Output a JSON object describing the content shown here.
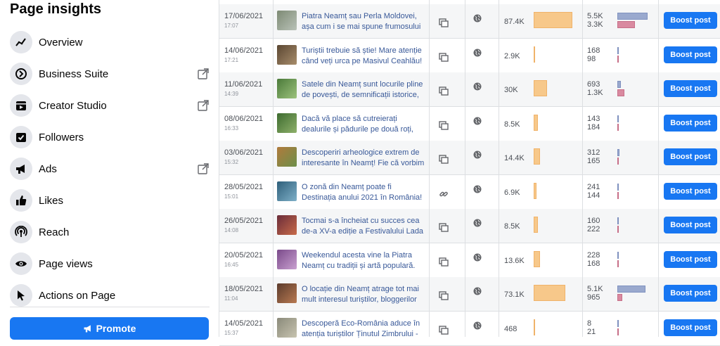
{
  "sidebar": {
    "title": "Page insights",
    "items": [
      {
        "label": "Overview",
        "icon": "trend-icon",
        "external": false
      },
      {
        "label": "Business Suite",
        "icon": "business-suite-icon",
        "external": true
      },
      {
        "label": "Creator Studio",
        "icon": "creator-studio-icon",
        "external": true
      },
      {
        "label": "Followers",
        "icon": "followers-icon",
        "external": false
      },
      {
        "label": "Ads",
        "icon": "megaphone-icon",
        "external": true
      },
      {
        "label": "Likes",
        "icon": "thumbs-up-icon",
        "external": false
      },
      {
        "label": "Reach",
        "icon": "broadcast-icon",
        "external": false
      },
      {
        "label": "Page views",
        "icon": "eye-icon",
        "external": false
      },
      {
        "label": "Actions on Page",
        "icon": "cursor-icon",
        "external": false
      }
    ],
    "promote_label": "Promote"
  },
  "colors": {
    "accent": "#1877f2",
    "reach_bar": "#f7c88a",
    "engagement_bar_1": "#9aa9ce",
    "engagement_bar_2": "#d98aa0"
  },
  "posts": [
    {
      "date": "17/06/2021",
      "time": "17:07",
      "text": "Piatra Neamț sau Perla Moldovei, așa cum i se mai spune frumosului oraș",
      "type": "copy-icon",
      "reach": "87.4K",
      "reach_fraction": 0.88,
      "eng1": "5.5K",
      "eng2": "3.3K",
      "eng1_fraction": 0.82,
      "eng2_fraction": 0.49,
      "boost": "Boost post",
      "thumb": [
        "#7d8a74",
        "#b9c2b8"
      ]
    },
    {
      "date": "14/06/2021",
      "time": "17:21",
      "text": "Turiștii trebuie să știe! Mare atenție când veți urca pe Masivul Ceahlău!",
      "type": "copy-icon",
      "reach": "2.9K",
      "reach_fraction": 0.03,
      "eng1": "168",
      "eng2": "98",
      "eng1_fraction": 0.03,
      "eng2_fraction": 0.02,
      "boost": "Boost post",
      "thumb": [
        "#5a4632",
        "#a88d6b"
      ]
    },
    {
      "date": "11/06/2021",
      "time": "14:39",
      "text": "Satele din Neamț sunt locurile pline de povești, de semnificații istorice, de",
      "type": "copy-icon",
      "reach": "30K",
      "reach_fraction": 0.3,
      "eng1": "693",
      "eng2": "1.3K",
      "eng1_fraction": 0.1,
      "eng2_fraction": 0.19,
      "boost": "Boost post",
      "thumb": [
        "#4b7a3a",
        "#9cc27c"
      ]
    },
    {
      "date": "08/06/2021",
      "time": "16:33",
      "text": "Dacă vă place să cutreierați dealurile și pădurile pe două roți, atunci aveți",
      "type": "copy-icon",
      "reach": "8.5K",
      "reach_fraction": 0.09,
      "eng1": "143",
      "eng2": "184",
      "eng1_fraction": 0.02,
      "eng2_fraction": 0.03,
      "boost": "Boost post",
      "thumb": [
        "#3d6b2f",
        "#8fb16b"
      ]
    },
    {
      "date": "03/06/2021",
      "time": "15:32",
      "text": "Descoperiri arheologice extrem de interesante în Neamț! Fie că vorbim",
      "type": "copy-icon",
      "reach": "14.4K",
      "reach_fraction": 0.15,
      "eng1": "312",
      "eng2": "165",
      "eng1_fraction": 0.05,
      "eng2_fraction": 0.02,
      "boost": "Boost post",
      "thumb": [
        "#b07a3c",
        "#6c8f4a"
      ]
    },
    {
      "date": "28/05/2021",
      "time": "15:01",
      "text": "O zonă din Neamț poate fi Destinația anului 2021 în România! O",
      "type": "link-icon",
      "reach": "6.9K",
      "reach_fraction": 0.07,
      "eng1": "241",
      "eng2": "144",
      "eng1_fraction": 0.04,
      "eng2_fraction": 0.02,
      "boost": "Boost post",
      "thumb": [
        "#2e5f7a",
        "#7fb0c8"
      ]
    },
    {
      "date": "26/05/2021",
      "time": "14:08",
      "text": "Tocmai s-a încheiat cu succes cea de-a XV-a ediție a Festivalului Lada",
      "type": "copy-icon",
      "reach": "8.5K",
      "reach_fraction": 0.09,
      "eng1": "160",
      "eng2": "222",
      "eng1_fraction": 0.02,
      "eng2_fraction": 0.03,
      "boost": "Boost post",
      "thumb": [
        "#6a2c3a",
        "#c86b4a"
      ]
    },
    {
      "date": "20/05/2021",
      "time": "16:45",
      "text": "Weekendul acesta vine la Piatra Neamț cu tradiții și artă populară.",
      "type": "copy-icon",
      "reach": "13.6K",
      "reach_fraction": 0.14,
      "eng1": "228",
      "eng2": "168",
      "eng1_fraction": 0.03,
      "eng2_fraction": 0.02,
      "boost": "Boost post",
      "thumb": [
        "#7a4a8a",
        "#c9a0d0"
      ]
    },
    {
      "date": "18/05/2021",
      "time": "11:04",
      "text": "O locație din Neamț atrage tot mai mult interesul turiștilor, bloggerilor de",
      "type": "copy-icon",
      "reach": "73.1K",
      "reach_fraction": 0.73,
      "eng1": "5.1K",
      "eng2": "965",
      "eng1_fraction": 0.76,
      "eng2_fraction": 0.14,
      "boost": "Boost post",
      "thumb": [
        "#5b3b2c",
        "#b97a52"
      ]
    },
    {
      "date": "14/05/2021",
      "time": "15:37",
      "text": "Descoperă Eco-România aduce în atenția turiștilor Ținutul Zimbrului -",
      "type": "copy-icon",
      "reach": "468",
      "reach_fraction": 0.005,
      "eng1": "8",
      "eng2": "21",
      "eng1_fraction": 0.002,
      "eng2_fraction": 0.004,
      "boost": "Boost post",
      "thumb": [
        "#8a8a7a",
        "#c8c4b0"
      ]
    }
  ]
}
